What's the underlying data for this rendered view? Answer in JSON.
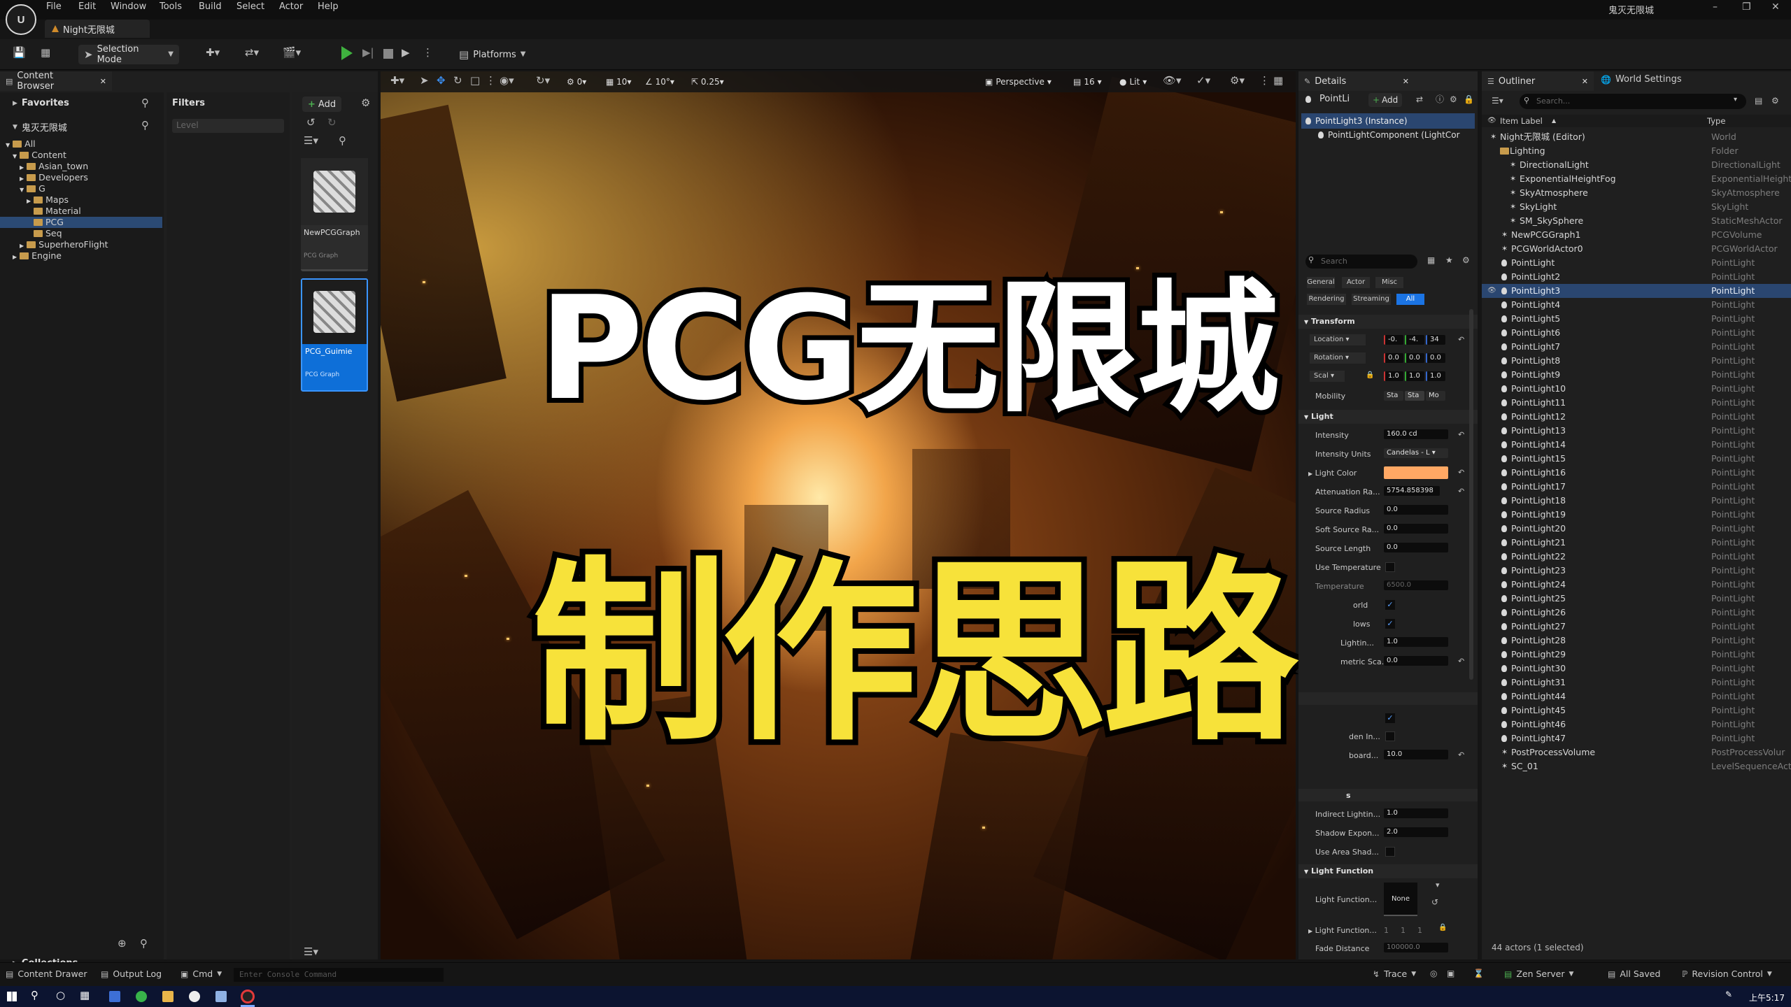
{
  "window": {
    "title": "鬼灭无限城",
    "tab": "Night无限城"
  },
  "menu": [
    "File",
    "Edit",
    "Window",
    "Tools",
    "Build",
    "Select",
    "Actor",
    "Help"
  ],
  "toolbar": {
    "mode": "Selection Mode",
    "platforms": "Platforms"
  },
  "content_browser": {
    "tab": "Content Browser",
    "favorites": "Favorites",
    "project": "鬼灭无限城",
    "filters": "Filters",
    "filter_placeholder": "Level",
    "add": "Add",
    "tree": [
      "All",
      "Content",
      "Asian_town",
      "Developers",
      "G",
      "Maps",
      "Material",
      "PCG",
      "Seq",
      "SuperheroFlight",
      "Engine"
    ],
    "assets": [
      {
        "name": "NewPCGGraph",
        "type": "PCG Graph"
      },
      {
        "name": "PCG_Guimie",
        "type": "PCG Graph"
      }
    ],
    "collections": "Collections"
  },
  "viewport": {
    "perspective": "Perspective",
    "lit": "Lit",
    "grid": "10",
    "rot": "10°",
    "scale": "0.25",
    "speed": "16",
    "cam": "0",
    "headline1": "PCG无限城",
    "headline2": "制作思路"
  },
  "details": {
    "tab": "Details",
    "actor": "PointLi",
    "add": "Add",
    "instance": "PointLight3 (Instance)",
    "component": "PointLightComponent (LightCor",
    "search": "Search",
    "filters": [
      "General",
      "Actor",
      "Misc",
      "Rendering",
      "Streaming",
      "All"
    ],
    "sections": {
      "transform": "Transform",
      "light": "Light",
      "light_function": "Light Function"
    },
    "location": "Location",
    "rotation": "Rotation",
    "scale": "Scal",
    "loc_vals": [
      "-0.",
      "-4.",
      "34"
    ],
    "rot_vals": [
      "0.0",
      "0.0",
      "0.0"
    ],
    "scale_vals": [
      "1.0",
      "1.0",
      "1.0"
    ],
    "mobility": "Mobility",
    "mob_vals": [
      "Sta",
      "Sta",
      "Mo"
    ],
    "props": [
      {
        "label": "Intensity",
        "value": "160.0 cd"
      },
      {
        "label": "Intensity Units",
        "value": "Candelas - L"
      },
      {
        "label": "Light Color",
        "value": ""
      },
      {
        "label": "Attenuation Ra...",
        "value": "5754.858398"
      },
      {
        "label": "Source Radius",
        "value": "0.0"
      },
      {
        "label": "Soft Source Ra...",
        "value": "0.0"
      },
      {
        "label": "Source Length",
        "value": "0.0"
      },
      {
        "label": "Use Temperature",
        "value": ""
      },
      {
        "label": "Temperature",
        "value": "6500.0"
      }
    ],
    "partial": [
      "orld",
      "lows",
      "Lightin...",
      "metric Sca...",
      "den In...",
      "board...",
      "s"
    ],
    "partial_vals": [
      "1.0",
      "0.0",
      "10.0"
    ],
    "lower": [
      {
        "label": "Indirect Lightin...",
        "value": "1.0"
      },
      {
        "label": "Shadow Expon...",
        "value": "2.0"
      },
      {
        "label": "Use Area Shad...",
        "value": ""
      }
    ],
    "lf_label": "Light Function...",
    "lf_value": "None",
    "lf_label2": "Light Function...",
    "lf_nums": [
      "1",
      "1",
      "1"
    ],
    "fade": "Fade Distance",
    "fade_value": "100000.0",
    "light_color": "#ffa864"
  },
  "outliner": {
    "tab": "Outliner",
    "world_settings": "World Settings",
    "search": "Search...",
    "col_label": "Item Label",
    "col_type": "Type",
    "rows": [
      {
        "label": "Night无限城 (Editor)",
        "type": "World"
      },
      {
        "label": "Lighting",
        "type": "Folder"
      },
      {
        "label": "DirectionalLight",
        "type": "DirectionalLight"
      },
      {
        "label": "ExponentialHeightFog",
        "type": "ExponentialHeightF"
      },
      {
        "label": "SkyAtmosphere",
        "type": "SkyAtmosphere"
      },
      {
        "label": "SkyLight",
        "type": "SkyLight"
      },
      {
        "label": "SM_SkySphere",
        "type": "StaticMeshActor"
      },
      {
        "label": "NewPCGGraph1",
        "type": "PCGVolume"
      },
      {
        "label": "PCGWorldActor0",
        "type": "PCGWorldActor"
      },
      {
        "label": "PointLight",
        "type": "PointLight"
      },
      {
        "label": "PointLight2",
        "type": "PointLight"
      },
      {
        "label": "PointLight3",
        "type": "PointLight"
      },
      {
        "label": "PointLight4",
        "type": "PointLight"
      },
      {
        "label": "PointLight5",
        "type": "PointLight"
      },
      {
        "label": "PointLight6",
        "type": "PointLight"
      },
      {
        "label": "PointLight7",
        "type": "PointLight"
      },
      {
        "label": "PointLight8",
        "type": "PointLight"
      },
      {
        "label": "PointLight9",
        "type": "PointLight"
      },
      {
        "label": "PointLight10",
        "type": "PointLight"
      },
      {
        "label": "PointLight11",
        "type": "PointLight"
      },
      {
        "label": "PointLight12",
        "type": "PointLight"
      },
      {
        "label": "PointLight13",
        "type": "PointLight"
      },
      {
        "label": "PointLight14",
        "type": "PointLight"
      },
      {
        "label": "PointLight15",
        "type": "PointLight"
      },
      {
        "label": "PointLight16",
        "type": "PointLight"
      },
      {
        "label": "PointLight17",
        "type": "PointLight"
      },
      {
        "label": "PointLight18",
        "type": "PointLight"
      },
      {
        "label": "PointLight19",
        "type": "PointLight"
      },
      {
        "label": "PointLight20",
        "type": "PointLight"
      },
      {
        "label": "PointLight21",
        "type": "PointLight"
      },
      {
        "label": "PointLight22",
        "type": "PointLight"
      },
      {
        "label": "PointLight23",
        "type": "PointLight"
      },
      {
        "label": "PointLight24",
        "type": "PointLight"
      },
      {
        "label": "PointLight25",
        "type": "PointLight"
      },
      {
        "label": "PointLight26",
        "type": "PointLight"
      },
      {
        "label": "PointLight27",
        "type": "PointLight"
      },
      {
        "label": "PointLight28",
        "type": "PointLight"
      },
      {
        "label": "PointLight29",
        "type": "PointLight"
      },
      {
        "label": "PointLight30",
        "type": "PointLight"
      },
      {
        "label": "PointLight31",
        "type": "PointLight"
      },
      {
        "label": "PointLight44",
        "type": "PointLight"
      },
      {
        "label": "PointLight45",
        "type": "PointLight"
      },
      {
        "label": "PointLight46",
        "type": "PointLight"
      },
      {
        "label": "PointLight47",
        "type": "PointLight"
      },
      {
        "label": "PostProcessVolume",
        "type": "PostProcessVolur"
      },
      {
        "label": "SC_01",
        "type": "LevelSequenceActo"
      }
    ],
    "footer": "44 actors (1 selected)"
  },
  "statusbar": {
    "drawer": "Content Drawer",
    "output": "Output Log",
    "cmd": "Cmd",
    "console": "Enter Console Command",
    "trace": "Trace",
    "zen": "Zen Server",
    "saved": "All Saved",
    "revision": "Revision Control"
  },
  "taskbar": {
    "time": "上午5:17"
  }
}
